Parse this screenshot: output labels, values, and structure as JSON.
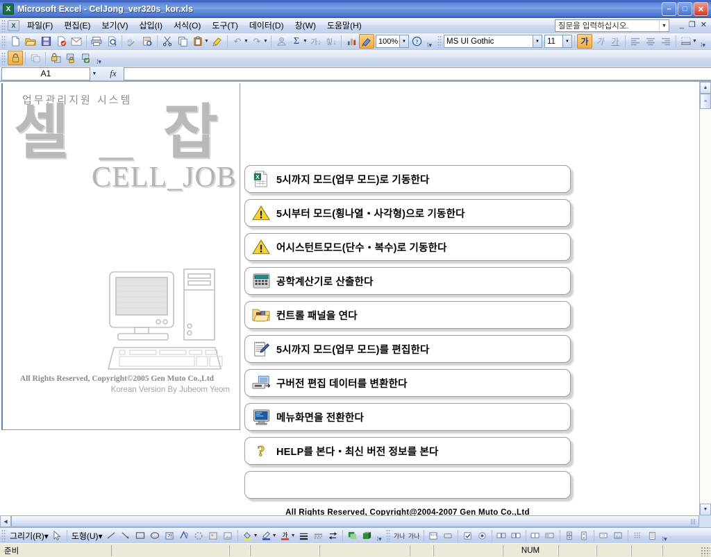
{
  "window": {
    "title": "Microsoft Excel - CelJong_ver320s_kor.xls",
    "app_icon": "excel-icon",
    "minimize": "–",
    "maximize": "□",
    "close": "✕"
  },
  "menubar": {
    "items": [
      {
        "label": "파일(F)"
      },
      {
        "label": "편집(E)"
      },
      {
        "label": "보기(V)"
      },
      {
        "label": "삽입(I)"
      },
      {
        "label": "서식(O)"
      },
      {
        "label": "도구(T)"
      },
      {
        "label": "데이터(D)"
      },
      {
        "label": "창(W)"
      },
      {
        "label": "도움말(H)"
      }
    ],
    "ask_box_placeholder": "질문을 입력하십시오.",
    "doc_minimize": "_",
    "doc_restore": "❐",
    "doc_close": "✕"
  },
  "standard_toolbar": {
    "buttons": [
      {
        "name": "new-icon",
        "glyph": "📄"
      },
      {
        "name": "open-icon",
        "glyph": "📂"
      },
      {
        "name": "save-icon",
        "glyph": "💾"
      },
      {
        "name": "permission-icon",
        "glyph": "🔏"
      },
      {
        "name": "email-icon",
        "glyph": "✉"
      },
      {
        "name": "print-icon",
        "glyph": "🖨"
      },
      {
        "name": "print-preview-icon",
        "glyph": "🔍"
      },
      {
        "name": "spelling-icon",
        "glyph": "✓"
      },
      {
        "name": "research-icon",
        "glyph": "📑"
      },
      {
        "name": "cut-icon",
        "glyph": "✂"
      },
      {
        "name": "copy-icon",
        "glyph": "⧉"
      },
      {
        "name": "paste-icon",
        "glyph": "📋"
      },
      {
        "name": "format-painter-icon",
        "glyph": "🖌"
      },
      {
        "name": "undo-icon",
        "glyph": "↶"
      },
      {
        "name": "redo-icon",
        "glyph": "↷"
      },
      {
        "name": "hyperlink-icon",
        "glyph": "🔗"
      },
      {
        "name": "autosum-icon",
        "glyph": "Σ"
      },
      {
        "name": "sort-asc-icon",
        "glyph": "↓"
      },
      {
        "name": "sort-desc-icon",
        "glyph": "↓"
      },
      {
        "name": "chart-wizard-icon",
        "glyph": "📊"
      },
      {
        "name": "drawing-icon",
        "glyph": "◩"
      }
    ],
    "zoom_value": "100%",
    "help_icon": "help-icon"
  },
  "protection_toolbar": {
    "buttons": [
      {
        "name": "unprotect-sheet-icon",
        "glyph": "🔒",
        "active": true
      },
      {
        "name": "allow-users-icon",
        "glyph": "▦"
      },
      {
        "name": "protect-sheet-icon",
        "glyph": "🔐"
      },
      {
        "name": "protect-workbook-icon",
        "glyph": "🔓"
      },
      {
        "name": "protect-share-icon",
        "glyph": "🛡"
      }
    ]
  },
  "formatting_toolbar": {
    "font_name": "MS UI Gothic",
    "font_size": "11",
    "bold_label": "가",
    "italic_label": "가",
    "underline_label": "가",
    "align_left": "≡",
    "align_center": "≡",
    "align_right": "≡",
    "borders_icon": "borders-icon"
  },
  "formula_bar": {
    "name_box_value": "A1",
    "fx_label": "fx",
    "formula_value": ""
  },
  "brand": {
    "subtitle": "업무관리지원 시스템",
    "logo_kr": "셀_잡",
    "logo_en": "CELL_JOB",
    "copyright": "All Rights Reserved, Copyright©2005 Gen Muto Co.,Ltd",
    "translator": "Korean Version By Jubeom Yeom"
  },
  "menu_buttons": [
    {
      "icon": "excel-document-icon",
      "label": "5시까지 모드(업무 모드)로 기동한다"
    },
    {
      "icon": "warning-icon",
      "label": "5시부터 모드(횡나열・사각형)으로 기동한다"
    },
    {
      "icon": "warning-icon",
      "label": "어시스턴트모드(단수・복수)로 기동한다"
    },
    {
      "icon": "calculator-icon",
      "label": "공학계산기로 산출한다"
    },
    {
      "icon": "control-panel-icon",
      "label": "컨트롤 패널을 연다"
    },
    {
      "icon": "notepad-edit-icon",
      "label": "5시까지 모드(업무 모드)를 편집한다"
    },
    {
      "icon": "data-convert-icon",
      "label": "구버전 편집 데이터를 변환한다"
    },
    {
      "icon": "monitor-icon",
      "label": "메뉴화면을 전환한다"
    },
    {
      "icon": "question-icon",
      "label": "HELP를 본다・최신 버전 정보를 본다"
    },
    {
      "icon": "",
      "label": ""
    }
  ],
  "bottom_copyright": "All Rights Reserved, Copyright@2004-2007 Gen Muto Co.,Ltd",
  "drawing_toolbar": {
    "draw_menu": "그리기(R)",
    "draw_menu_arrow": "▾",
    "select_icon": "select-arrow-icon",
    "shapes_menu": "도형(U)",
    "shapes_menu_arrow": "▾",
    "tools": [
      {
        "name": "line-icon",
        "glyph": "╲"
      },
      {
        "name": "arrow-icon",
        "glyph": "↘"
      },
      {
        "name": "rectangle-icon",
        "glyph": "▭"
      },
      {
        "name": "oval-icon",
        "glyph": "◯"
      },
      {
        "name": "textbox-icon",
        "glyph": "▣"
      },
      {
        "name": "wordart-icon",
        "glyph": "🅰"
      },
      {
        "name": "diagram-icon",
        "glyph": "◌"
      },
      {
        "name": "clipart-icon",
        "glyph": "▩"
      },
      {
        "name": "picture-icon",
        "glyph": "🖼"
      },
      {
        "name": "fill-color-icon",
        "glyph": "🪣"
      },
      {
        "name": "line-color-icon",
        "glyph": "🖊"
      },
      {
        "name": "font-color-icon",
        "glyph": "가"
      },
      {
        "name": "line-style-icon",
        "glyph": "≡"
      },
      {
        "name": "dash-style-icon",
        "glyph": "┄"
      },
      {
        "name": "arrow-style-icon",
        "glyph": "⇄"
      },
      {
        "name": "shadow-style-icon",
        "glyph": "▪"
      },
      {
        "name": "3d-style-icon",
        "glyph": "◙"
      }
    ]
  },
  "control_toolbox": {
    "buttons": [
      {
        "name": "design-mode-icon",
        "glyph": "가나"
      },
      {
        "name": "properties-icon",
        "glyph": "가나"
      },
      {
        "name": "view-code-icon",
        "glyph": "▤"
      },
      {
        "name": "command-button-icon",
        "glyph": "▭"
      },
      {
        "name": "checkbox-icon",
        "glyph": "☑"
      },
      {
        "name": "option-button-icon",
        "glyph": "◉"
      },
      {
        "name": "textbox-ctl-icon",
        "glyph": "▤"
      },
      {
        "name": "listbox-icon",
        "glyph": "▤"
      },
      {
        "name": "combobox-icon",
        "glyph": "▤"
      },
      {
        "name": "togglebutton-icon",
        "glyph": "▤"
      },
      {
        "name": "spinbutton-icon",
        "glyph": "⇕"
      },
      {
        "name": "scrollbar-icon",
        "glyph": "⇕"
      },
      {
        "name": "label-icon",
        "glyph": "▣"
      },
      {
        "name": "image-ctl-icon",
        "glyph": "▧"
      },
      {
        "name": "more-controls-icon",
        "glyph": "⋮⋮"
      },
      {
        "name": "properties2-icon",
        "glyph": "▤"
      }
    ]
  },
  "status_bar": {
    "ready_text": "준비",
    "num_lock": "NUM"
  },
  "colors": {
    "titlebar_blue": "#3a5fc0",
    "toolbar_bg": "#dfe8f7",
    "statusbar_bg": "#ece9d8",
    "button_border": "#9d9d9d",
    "accent_orange": "#f5ab3f"
  }
}
